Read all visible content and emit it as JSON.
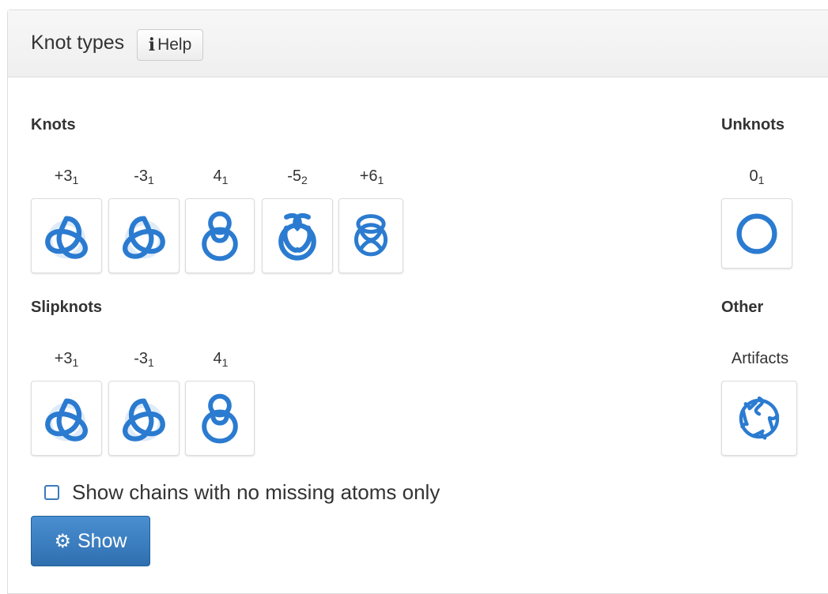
{
  "panel": {
    "title": "Knot types",
    "help_label": "Help"
  },
  "sections": {
    "knots": "Knots",
    "unknots": "Unknots",
    "slipknots": "Slipknots",
    "other": "Other"
  },
  "knots": [
    {
      "base": "+3",
      "sub": "1",
      "icon": "trefoil-knot-icon"
    },
    {
      "base": "-3",
      "sub": "1",
      "icon": "trefoil-knot-icon"
    },
    {
      "base": "4",
      "sub": "1",
      "icon": "figure-eight-knot-icon"
    },
    {
      "base": "-5",
      "sub": "2",
      "icon": "knot-5-2-icon"
    },
    {
      "base": "+6",
      "sub": "1",
      "icon": "knot-6-1-icon"
    }
  ],
  "unknots": [
    {
      "base": "0",
      "sub": "1",
      "icon": "unknot-ring-icon"
    }
  ],
  "slipknots": [
    {
      "base": "+3",
      "sub": "1",
      "icon": "trefoil-knot-icon"
    },
    {
      "base": "-3",
      "sub": "1",
      "icon": "trefoil-knot-icon"
    },
    {
      "base": "4",
      "sub": "1",
      "icon": "figure-eight-knot-icon"
    }
  ],
  "other": [
    {
      "label": "Artifacts",
      "icon": "artifact-knot-icon"
    }
  ],
  "filter": {
    "checkbox_label": "Show chains with no missing atoms only",
    "checked": false
  },
  "show_button": {
    "label": "Show",
    "icon": "gears-icon"
  },
  "colors": {
    "knot_blue": "#2b7bd0",
    "button_blue": "#3b7fc4"
  }
}
